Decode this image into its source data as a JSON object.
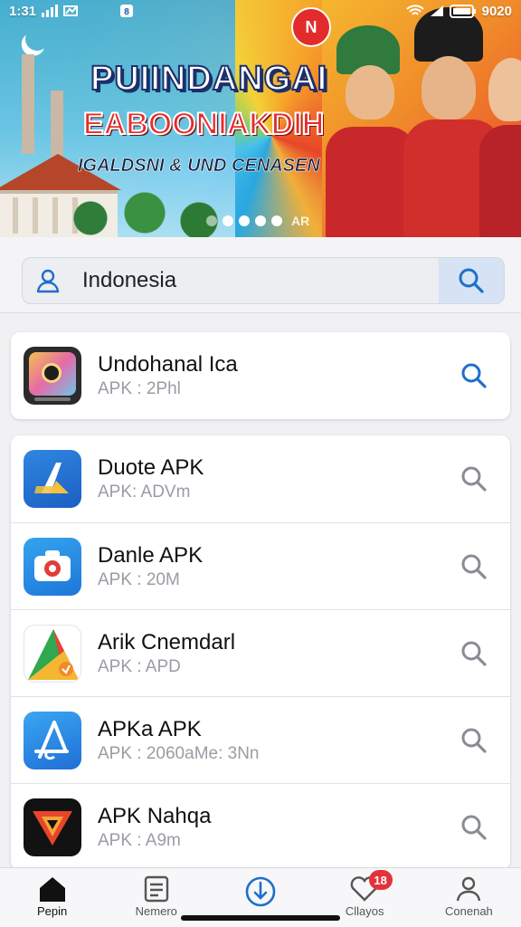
{
  "status_bar": {
    "time": "1:31",
    "battery": "9020"
  },
  "banner": {
    "title_line1": "PUIINDANGAI",
    "title_line2": "EABOONIAKDIH",
    "subtitle": "IGALDSNI & UND CENASEN",
    "logo_text": "N",
    "dots_label": "AR",
    "slide_count": 5,
    "active_slide": 1
  },
  "search": {
    "value": "Indonesia",
    "placeholder": ""
  },
  "featured": {
    "name": "Undohanal Ica",
    "sub": "APK : 2Phl"
  },
  "apps": [
    {
      "name": "Duote APK",
      "sub": "APK: ADVm",
      "icon": "dart-launcher-icon"
    },
    {
      "name": "Danle APK",
      "sub": "APK : 20M",
      "icon": "camera-pin-icon"
    },
    {
      "name": "Arik Cnemdarl",
      "sub": "APK : APD",
      "icon": "multicolor-a-icon"
    },
    {
      "name": "APKa APK",
      "sub": "APK : 2060aMe: 3Nn",
      "icon": "app-store-a-icon"
    },
    {
      "name": "APK Nahqa",
      "sub": "APK : A9m",
      "icon": "shield-logo-icon"
    }
  ],
  "nav": {
    "items": [
      {
        "label": "Pepin"
      },
      {
        "label": "Nemero"
      },
      {
        "label": ""
      },
      {
        "label": "Cllayos",
        "badge": "18"
      },
      {
        "label": "Conenah"
      }
    ]
  },
  "colors": {
    "accent": "#1f6fc9",
    "badge": "#e2333a"
  }
}
